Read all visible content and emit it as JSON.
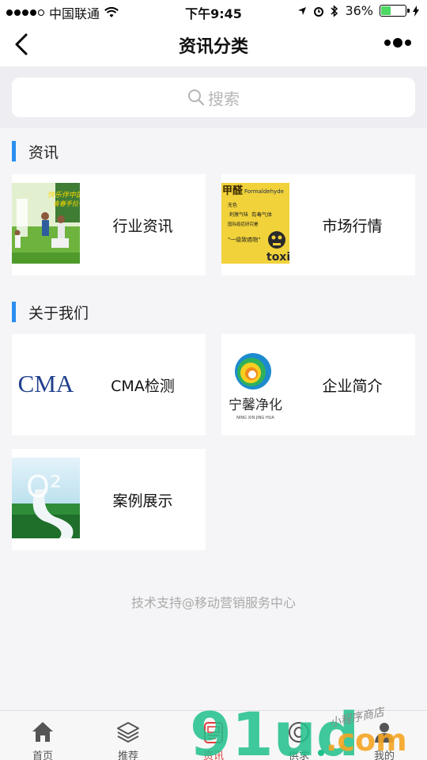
{
  "status_bar": {
    "carrier": "中国联通",
    "time": "下午9:45",
    "battery": "36%",
    "battery_level": 0.36
  },
  "nav": {
    "title": "资讯分类"
  },
  "search": {
    "placeholder": "搜索"
  },
  "sections": [
    {
      "title": "资讯",
      "items": [
        {
          "label": "行业资讯"
        },
        {
          "label": "市场行情",
          "thumb_text": {
            "t1": "甲醛",
            "t2": "Formaldehyde",
            "t3": "无色",
            "t4": "刺激气味",
            "t5": "有毒气体",
            "t6": "国际癌症研究署",
            "t7": "\"一级致癌物\"",
            "t8": "toxic"
          }
        }
      ]
    },
    {
      "title": "关于我们",
      "items": [
        {
          "label": "CMA检测",
          "thumb_text": "CMA"
        },
        {
          "label": "企业简介",
          "thumb_text": {
            "name": "宁馨净化",
            "pinyin": "NING XIN JING HUA"
          }
        },
        {
          "label": "案例展示",
          "thumb_text": "O²"
        }
      ]
    }
  ],
  "footer": {
    "text": "技术支持@移动营销服务中心"
  },
  "tabs": [
    {
      "label": "首页",
      "icon": "home-icon"
    },
    {
      "label": "推荐",
      "icon": "layers-icon"
    },
    {
      "label": "资讯",
      "icon": "news-icon"
    },
    {
      "label": "供求",
      "icon": "supply-icon"
    },
    {
      "label": "我的",
      "icon": "user-icon"
    }
  ],
  "watermark": {
    "brand": "91ud",
    "suffix": ".com",
    "slogan": "小程序商店"
  },
  "colors": {
    "accent": "#2b8ef0",
    "active_tab": "#e43c3c",
    "battery": "#4cd964"
  }
}
